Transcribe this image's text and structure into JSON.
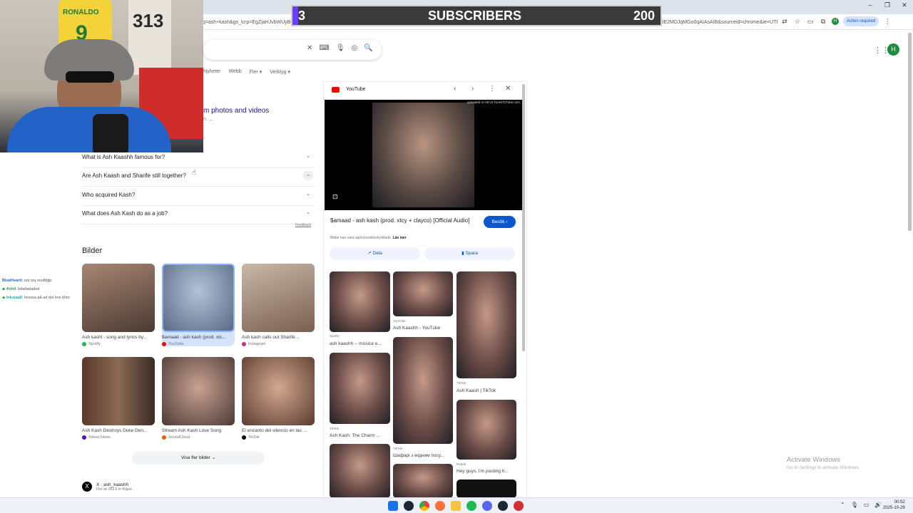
{
  "browser": {
    "url": "oq=ash+kash&gs_lcrp=EgZjaHJvbWUyBggAEEUYOTIHCAEQABiABDIHCAIQABiABDIHCAMQABiABDIHCAQQABiABDIHCAUQABiABDIHCAYQABiABDIHCAcQABiABDIHCAgQABiABDIHCAkQABiABNIBCDE2MDJqMGo0qAIAsAIB&sourceid=chrome&ie=UTF-8#vhid...",
    "action_required": "Action required",
    "profile_initial": "H"
  },
  "subscribers": {
    "current": "3",
    "label": "SUBSCRIBERS",
    "goal": "200",
    "progress": 0.015,
    "bar_color": "#6a40ff"
  },
  "webcam": {
    "jersey_name": "RONALDO",
    "jersey_number": "9",
    "jersey2_number": "313"
  },
  "search": {
    "tabs": [
      "Nyheter",
      "Webb",
      "Fler ▾",
      "Verktyg ▾"
    ],
    "avatar": "H"
  },
  "results": {
    "title": "m photos and videos",
    "snippet": "n. ..."
  },
  "people_also_ask": [
    "What is Ash Kaashh famous for?",
    "Are Ash Kaash and Sharife still together?",
    "Who acquired Kash?",
    "What does Ash Kash do as a job?"
  ],
  "feedback": "Feedback",
  "images": {
    "heading": "Bilder",
    "items": [
      {
        "caption": "Ash kashl - song and lyrics by...",
        "source": "Spotify",
        "color": "#1db954"
      },
      {
        "caption": "$amaad - ash kash (prod. xtc...",
        "source": "YouTube",
        "color": "#ff0000"
      },
      {
        "caption": "Ash kash calls out Sharife...",
        "source": "Instagram",
        "color": "#c13584"
      },
      {
        "caption": "Ash Kash Destroys Duke Den...",
        "source": "Yahoo News",
        "color": "#6001d2"
      },
      {
        "caption": "Stream Ash Kash Love Song",
        "source": "SoundCloud",
        "color": "#ff5500"
      },
      {
        "caption": "El encanto del silencio en las ...",
        "source": "TikTok",
        "color": "#000000"
      }
    ],
    "more": "Visa fler bilder"
  },
  "x_result": {
    "handle": "X · ash_kaashh",
    "followers": "Fler än 953,6 tn följare"
  },
  "chat": [
    {
      "name": "BlueHeartt",
      "msg": ": ooj ooj ooufdjtjp",
      "color": "#2a5fd6"
    },
    {
      "name": "Ash4",
      "msg": ": bdsdadadsd",
      "color": "#2aa84f"
    },
    {
      "name": "Inkstaa8",
      "msg": ": hvsssa på ad dol hns bhnr",
      "color": "#2aa8a8"
    }
  ],
  "panel": {
    "source": "YouTube",
    "uploaded": "uploaded in HD at TunesToTube.com",
    "title": "$amaad - ash kash (prod. xtcy + clayco) [Official Audio]",
    "note": "Bilder kan vara upphovsrättsskyddade.",
    "note_link": "Läs mer",
    "visit": "Besök ›",
    "share": "Dela",
    "save": "Spara",
    "related": [
      {
        "source": "Spotify",
        "caption": "ash kaashh -- música e..."
      },
      {
        "source": "YouTube",
        "caption": "Ash Kaashh - YouTube"
      },
      {
        "source": "TikTok",
        "caption": "Ash Kaash | TikTok"
      },
      {
        "source": "TikTok",
        "caption": "Ash Kash: The Charm ..."
      },
      {
        "source": "TikTok",
        "caption": "Шафарі з мідним посу..."
      },
      {
        "source": "Reddit",
        "caption": "Hey guys, I'm posting h..."
      }
    ]
  },
  "activate": {
    "title": "Activate Windows",
    "sub": "Go to Settings to activate Windows."
  },
  "clock": {
    "time": "00:52",
    "date": "2025-10-29"
  }
}
